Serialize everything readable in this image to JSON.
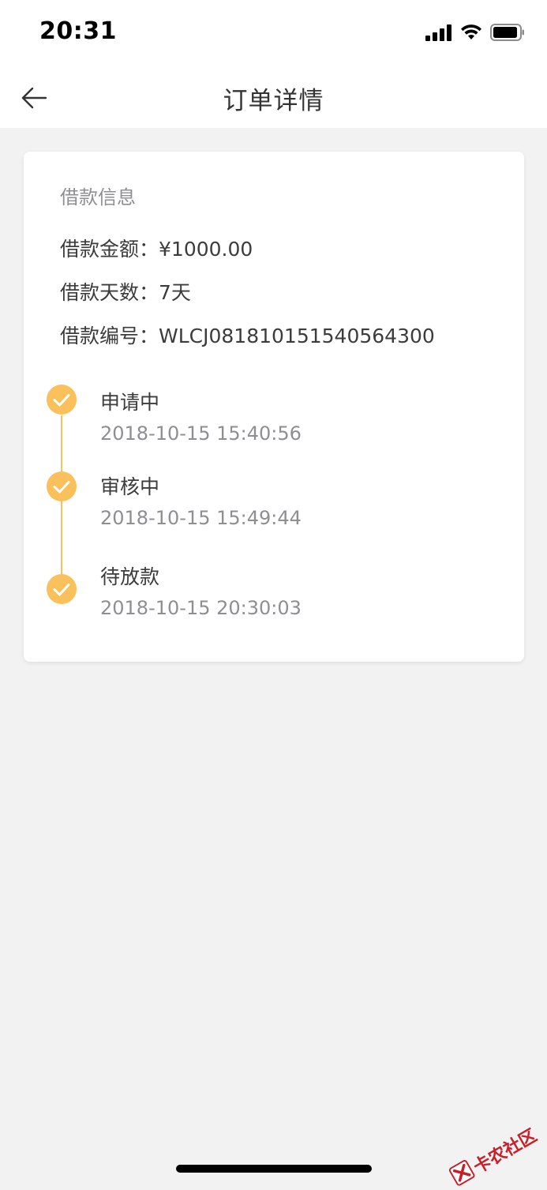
{
  "status_bar": {
    "time": "20:31"
  },
  "nav": {
    "title": "订单详情",
    "back_icon": "arrow-left-icon"
  },
  "loan_info": {
    "section_title": "借款信息",
    "amount_label": "借款金额：",
    "amount_value": "¥1000.00",
    "days_label": "借款天数：",
    "days_value": "7天",
    "number_label": "借款编号：",
    "number_value": "WLCJ081810151540564300"
  },
  "timeline": {
    "accent_color": "#f9c05c",
    "steps": [
      {
        "status": "申请中",
        "time": "2018-10-15 15:40:56",
        "icon": "check-circle-icon"
      },
      {
        "status": "审核中",
        "time": "2018-10-15 15:49:44",
        "icon": "check-circle-icon"
      },
      {
        "status": "待放款",
        "time": "2018-10-15 20:30:03",
        "icon": "check-circle-icon"
      }
    ]
  },
  "watermark": {
    "text": "卡农社区"
  }
}
